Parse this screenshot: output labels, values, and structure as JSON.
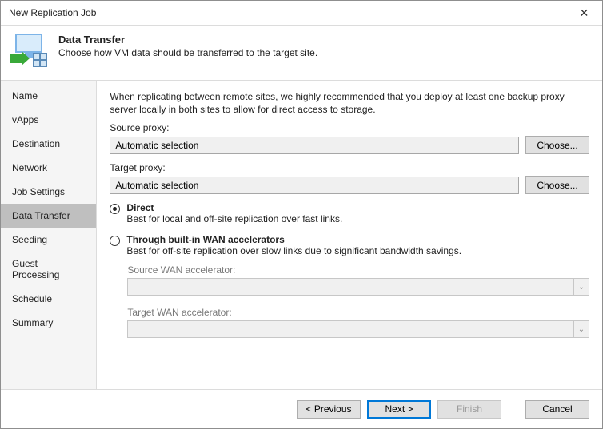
{
  "window": {
    "title": "New Replication Job"
  },
  "header": {
    "title": "Data Transfer",
    "subtitle": "Choose how VM data should be transferred to the target site."
  },
  "sidebar": {
    "items": [
      {
        "label": "Name"
      },
      {
        "label": "vApps"
      },
      {
        "label": "Destination"
      },
      {
        "label": "Network"
      },
      {
        "label": "Job Settings"
      },
      {
        "label": "Data Transfer",
        "active": true
      },
      {
        "label": "Seeding"
      },
      {
        "label": "Guest Processing"
      },
      {
        "label": "Schedule"
      },
      {
        "label": "Summary"
      }
    ]
  },
  "content": {
    "intro": "When replicating between remote sites, we highly recommended that you deploy at least one backup proxy server locally in both sites to allow for direct access to storage.",
    "source_proxy": {
      "label": "Source proxy:",
      "value": "Automatic selection",
      "button": "Choose..."
    },
    "target_proxy": {
      "label": "Target proxy:",
      "value": "Automatic selection",
      "button": "Choose..."
    },
    "radios": {
      "direct": {
        "title": "Direct",
        "desc": "Best for local and off-site replication over fast links."
      },
      "wan": {
        "title": "Through built-in WAN accelerators",
        "desc": "Best for off-site replication over slow links due to significant bandwidth savings."
      },
      "selected": "direct"
    },
    "wan_source": {
      "label": "Source WAN accelerator:",
      "value": ""
    },
    "wan_target": {
      "label": "Target WAN accelerator:",
      "value": ""
    }
  },
  "footer": {
    "previous": "< Previous",
    "next": "Next >",
    "finish": "Finish",
    "cancel": "Cancel"
  }
}
